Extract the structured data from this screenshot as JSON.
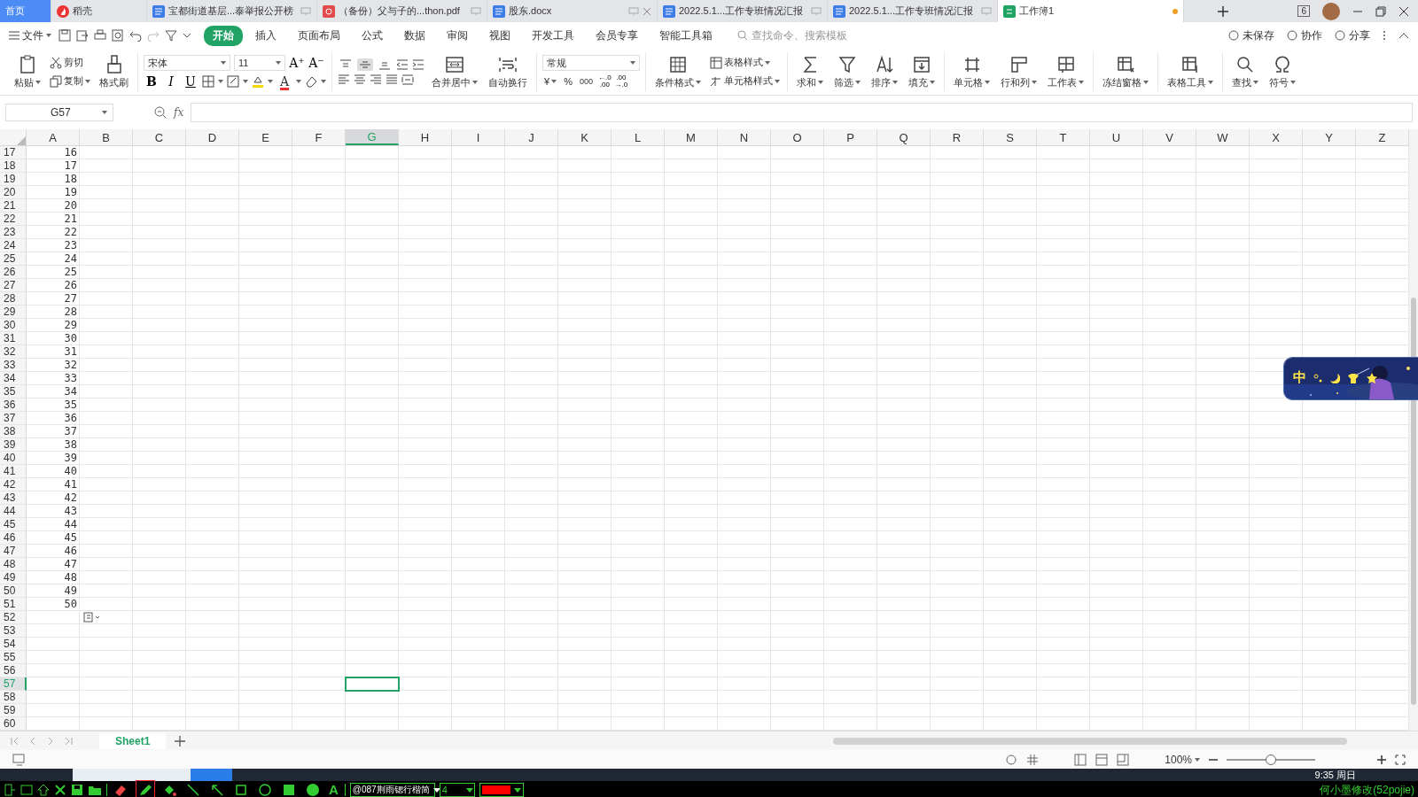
{
  "tabs": [
    {
      "kind": "home",
      "label": "首页",
      "selected": false,
      "closable": false,
      "modified": false
    },
    {
      "kind": "docer",
      "label": "稻壳",
      "selected": false,
      "closable": false,
      "modified": false
    },
    {
      "kind": "writer",
      "label": "宝都街道基层...泰举报公开榜",
      "selected": false,
      "closable": false,
      "modified": false
    },
    {
      "kind": "pdf",
      "label": "（备份）父与子的...thon.pdf",
      "selected": false,
      "closable": false,
      "modified": false
    },
    {
      "kind": "writer",
      "label": "股东.docx",
      "selected": false,
      "closable": true,
      "modified": false
    },
    {
      "kind": "writer",
      "label": "2022.5.1...工作专班情况汇报",
      "selected": false,
      "closable": false,
      "modified": false
    },
    {
      "kind": "writer",
      "label": "2022.5.1...工作专班情况汇报",
      "selected": false,
      "closable": false,
      "modified": false
    },
    {
      "kind": "sheet",
      "label": "工作簿1",
      "selected": true,
      "closable": false,
      "modified": true
    }
  ],
  "window_badge": "6",
  "menu": {
    "file": "文件",
    "items": [
      {
        "label": "开始",
        "selected": true
      },
      {
        "label": "插入",
        "selected": false
      },
      {
        "label": "页面布局",
        "selected": false
      },
      {
        "label": "公式",
        "selected": false
      },
      {
        "label": "数据",
        "selected": false
      },
      {
        "label": "审阅",
        "selected": false
      },
      {
        "label": "视图",
        "selected": false
      },
      {
        "label": "开发工具",
        "selected": false
      },
      {
        "label": "会员专享",
        "selected": false
      },
      {
        "label": "智能工具箱",
        "selected": false
      }
    ],
    "search_placeholder": "查找命令、搜索模板",
    "actions": [
      "未保存",
      "协作",
      "分享"
    ]
  },
  "ribbon": {
    "paste": "粘贴",
    "cut": "剪切",
    "copy": "复制",
    "format_painter": "格式刷",
    "font_name": "宋体",
    "font_size": "11",
    "grow": "A⁺",
    "shrink": "A⁻",
    "font_buttons": [
      "B",
      "I",
      "U"
    ],
    "font_color": "A",
    "vertical_align": [
      {
        "selected": false
      },
      {
        "selected": true
      },
      {
        "selected": false
      }
    ],
    "merge": "合并居中",
    "wrap": "自动换行",
    "number_format": "常规",
    "currency": "¥",
    "percent": "%",
    "thousands": "000",
    "inc_decimal": "←.0\n.00",
    "dec_decimal": ".00\n→.0",
    "conditional": "条件格式",
    "table_style": "表格样式",
    "cell_style": "单元格样式",
    "tools": [
      "求和",
      "筛选",
      "排序",
      "填充",
      "单元格",
      "行和列",
      "工作表",
      "冻结窗格",
      "表格工具",
      "查找",
      "符号"
    ]
  },
  "name_box": "G57",
  "fx": "fx",
  "columns": [
    {
      "label": "A",
      "selected": false
    },
    {
      "label": "B",
      "selected": false
    },
    {
      "label": "C",
      "selected": false
    },
    {
      "label": "D",
      "selected": false
    },
    {
      "label": "E",
      "selected": false
    },
    {
      "label": "F",
      "selected": false
    },
    {
      "label": "G",
      "selected": true
    },
    {
      "label": "H",
      "selected": false
    },
    {
      "label": "I",
      "selected": false
    },
    {
      "label": "J",
      "selected": false
    },
    {
      "label": "K",
      "selected": false
    },
    {
      "label": "L",
      "selected": false
    },
    {
      "label": "M",
      "selected": false
    },
    {
      "label": "N",
      "selected": false
    },
    {
      "label": "O",
      "selected": false
    },
    {
      "label": "P",
      "selected": false
    },
    {
      "label": "Q",
      "selected": false
    },
    {
      "label": "R",
      "selected": false
    },
    {
      "label": "S",
      "selected": false
    },
    {
      "label": "T",
      "selected": false
    },
    {
      "label": "U",
      "selected": false
    },
    {
      "label": "V",
      "selected": false
    },
    {
      "label": "W",
      "selected": false
    },
    {
      "label": "X",
      "selected": false
    },
    {
      "label": "Y",
      "selected": false
    },
    {
      "label": "Z",
      "selected": false
    }
  ],
  "rows": [
    {
      "number": "17",
      "cells": [
        "16"
      ],
      "selected": false
    },
    {
      "number": "18",
      "cells": [
        "17"
      ],
      "selected": false
    },
    {
      "number": "19",
      "cells": [
        "18"
      ],
      "selected": false
    },
    {
      "number": "20",
      "cells": [
        "19"
      ],
      "selected": false
    },
    {
      "number": "21",
      "cells": [
        "20"
      ],
      "selected": false
    },
    {
      "number": "22",
      "cells": [
        "21"
      ],
      "selected": false
    },
    {
      "number": "23",
      "cells": [
        "22"
      ],
      "selected": false
    },
    {
      "number": "24",
      "cells": [
        "23"
      ],
      "selected": false
    },
    {
      "number": "25",
      "cells": [
        "24"
      ],
      "selected": false
    },
    {
      "number": "26",
      "cells": [
        "25"
      ],
      "selected": false
    },
    {
      "number": "27",
      "cells": [
        "26"
      ],
      "selected": false
    },
    {
      "number": "28",
      "cells": [
        "27"
      ],
      "selected": false
    },
    {
      "number": "29",
      "cells": [
        "28"
      ],
      "selected": false
    },
    {
      "number": "30",
      "cells": [
        "29"
      ],
      "selected": false
    },
    {
      "number": "31",
      "cells": [
        "30"
      ],
      "selected": false
    },
    {
      "number": "32",
      "cells": [
        "31"
      ],
      "selected": false
    },
    {
      "number": "33",
      "cells": [
        "32"
      ],
      "selected": false
    },
    {
      "number": "34",
      "cells": [
        "33"
      ],
      "selected": false
    },
    {
      "number": "35",
      "cells": [
        "34"
      ],
      "selected": false
    },
    {
      "number": "36",
      "cells": [
        "35"
      ],
      "selected": false
    },
    {
      "number": "37",
      "cells": [
        "36"
      ],
      "selected": false
    },
    {
      "number": "38",
      "cells": [
        "37"
      ],
      "selected": false
    },
    {
      "number": "39",
      "cells": [
        "38"
      ],
      "selected": false
    },
    {
      "number": "40",
      "cells": [
        "39"
      ],
      "selected": false
    },
    {
      "number": "41",
      "cells": [
        "40"
      ],
      "selected": false
    },
    {
      "number": "42",
      "cells": [
        "41"
      ],
      "selected": false
    },
    {
      "number": "43",
      "cells": [
        "42"
      ],
      "selected": false
    },
    {
      "number": "44",
      "cells": [
        "43"
      ],
      "selected": false
    },
    {
      "number": "45",
      "cells": [
        "44"
      ],
      "selected": false
    },
    {
      "number": "46",
      "cells": [
        "45"
      ],
      "selected": false
    },
    {
      "number": "47",
      "cells": [
        "46"
      ],
      "selected": false
    },
    {
      "number": "48",
      "cells": [
        "47"
      ],
      "selected": false
    },
    {
      "number": "49",
      "cells": [
        "48"
      ],
      "selected": false
    },
    {
      "number": "50",
      "cells": [
        "49"
      ],
      "selected": false
    },
    {
      "number": "51",
      "cells": [
        "50"
      ],
      "selected": false
    },
    {
      "number": "52",
      "cells": [],
      "selected": false
    },
    {
      "number": "53",
      "cells": [],
      "selected": false
    },
    {
      "number": "54",
      "cells": [],
      "selected": false
    },
    {
      "number": "55",
      "cells": [],
      "selected": false
    },
    {
      "number": "56",
      "cells": [],
      "selected": false
    },
    {
      "number": "57",
      "cells": [],
      "selected": true
    },
    {
      "number": "58",
      "cells": [],
      "selected": false
    },
    {
      "number": "59",
      "cells": [],
      "selected": false
    },
    {
      "number": "60",
      "cells": [],
      "selected": false
    }
  ],
  "input_method": {
    "label": "中"
  },
  "sheet_tabs": [
    {
      "label": "Sheet1",
      "selected": true
    }
  ],
  "status_bar": {
    "zoom": "100%",
    "zoom_slider": {
      "level": 0.5
    }
  },
  "taskbar": {
    "time": "9:35 周日"
  },
  "tool_strip": {
    "tools": [
      {
        "selected": false
      },
      {
        "selected": true
      },
      {
        "selected": false
      },
      {
        "selected": false
      },
      {
        "selected": false
      },
      {
        "selected": false
      },
      {
        "selected": false
      },
      {
        "selected": false
      },
      {
        "selected": false
      },
      {
        "label": "A",
        "selected": false
      }
    ],
    "font": "@087荆雨锶行楷简",
    "size": "4",
    "credit": "何小墨修改(52pojie)"
  }
}
